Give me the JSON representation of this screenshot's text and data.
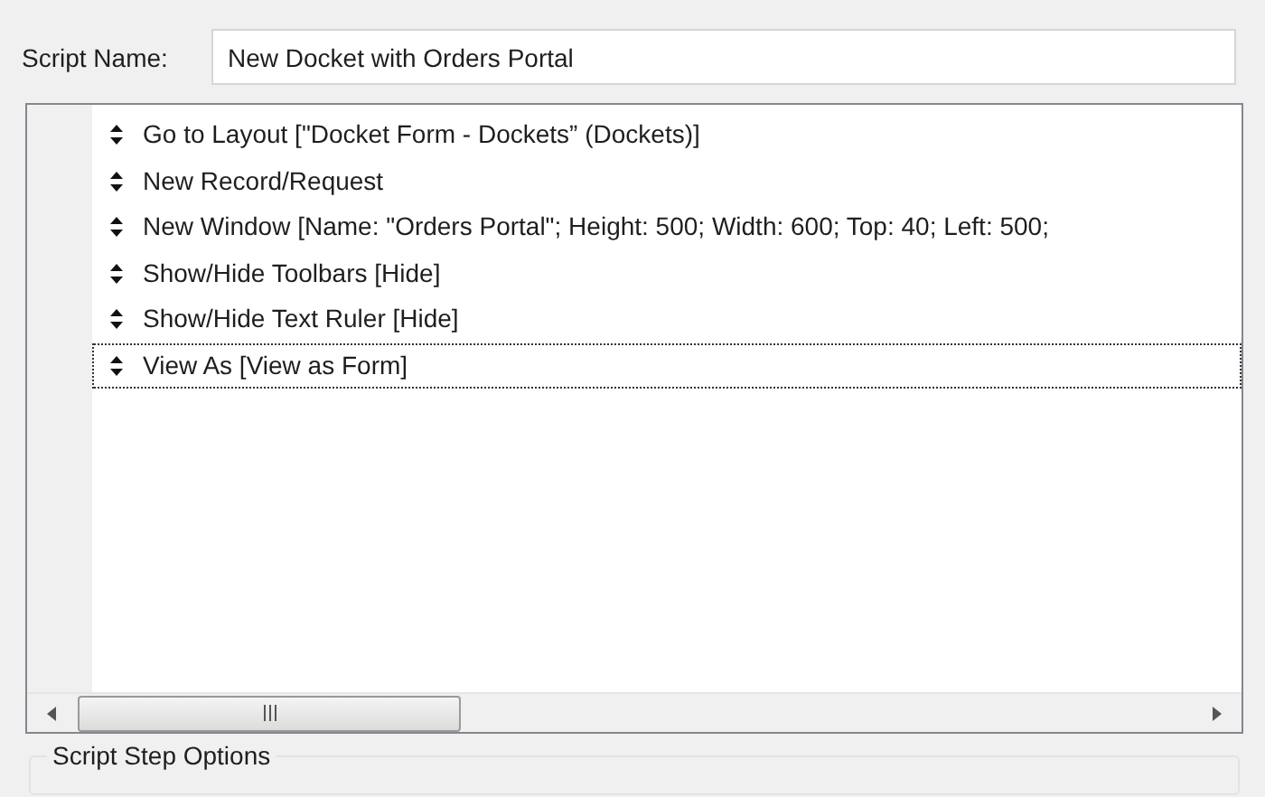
{
  "script_name": {
    "label": "Script Name:",
    "value": "New Docket with Orders Portal"
  },
  "steps": [
    {
      "text": "Go to Layout [\"Docket Form - Dockets” (Dockets)]",
      "selected": false
    },
    {
      "text": "New Record/Request",
      "selected": false
    },
    {
      "text": "New Window [Name: \"Orders Portal\"; Height: 500; Width: 600; Top: 40; Left: 500;",
      "selected": false
    },
    {
      "text": "Show/Hide Toolbars [Hide]",
      "selected": false
    },
    {
      "text": "Show/Hide Text Ruler [Hide]",
      "selected": false
    },
    {
      "text": "View As [View as Form]",
      "selected": true
    }
  ],
  "options_group": {
    "title": "Script Step Options"
  }
}
